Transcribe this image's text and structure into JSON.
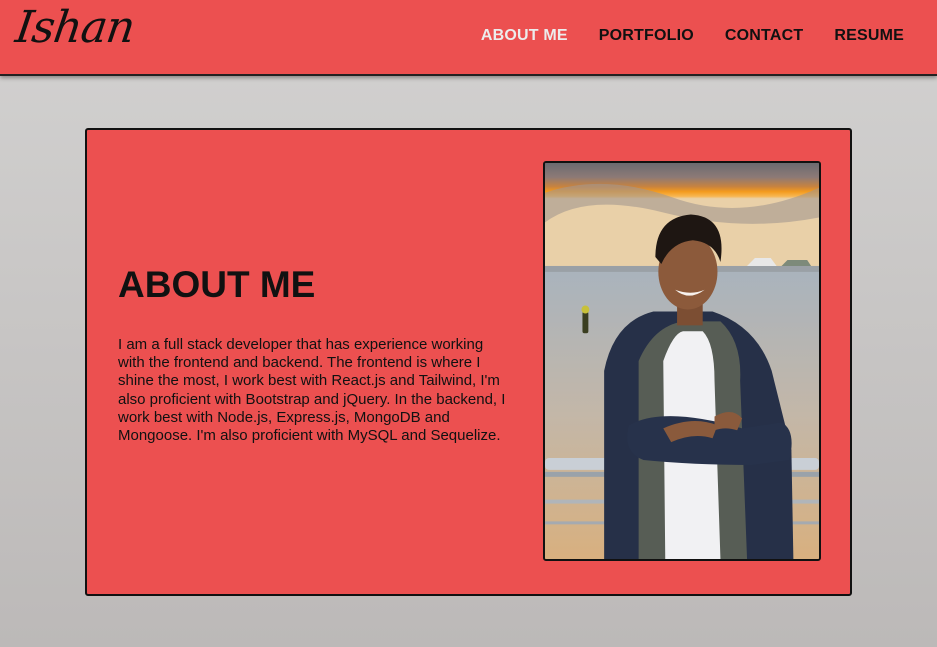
{
  "header": {
    "logo": "Ishan",
    "nav": [
      {
        "label": "ABOUT ME"
      },
      {
        "label": "PORTFOLIO"
      },
      {
        "label": "CONTACT"
      },
      {
        "label": "RESUME"
      }
    ]
  },
  "about": {
    "title": "ABOUT ME",
    "text": "I am a full stack developer that has experience working with the frontend and backend. The frontend is where I shine the most, I work best with React.js and Tailwind, I'm also proficient with Bootstrap and jQuery. In the backend, I work best with Node.js, Express.js, MongoDB and Mongoose. I'm also proficient with MySQL and Sequelize."
  },
  "colors": {
    "accent": "#ec5050",
    "active_nav": "#ececec",
    "text": "#111111"
  }
}
